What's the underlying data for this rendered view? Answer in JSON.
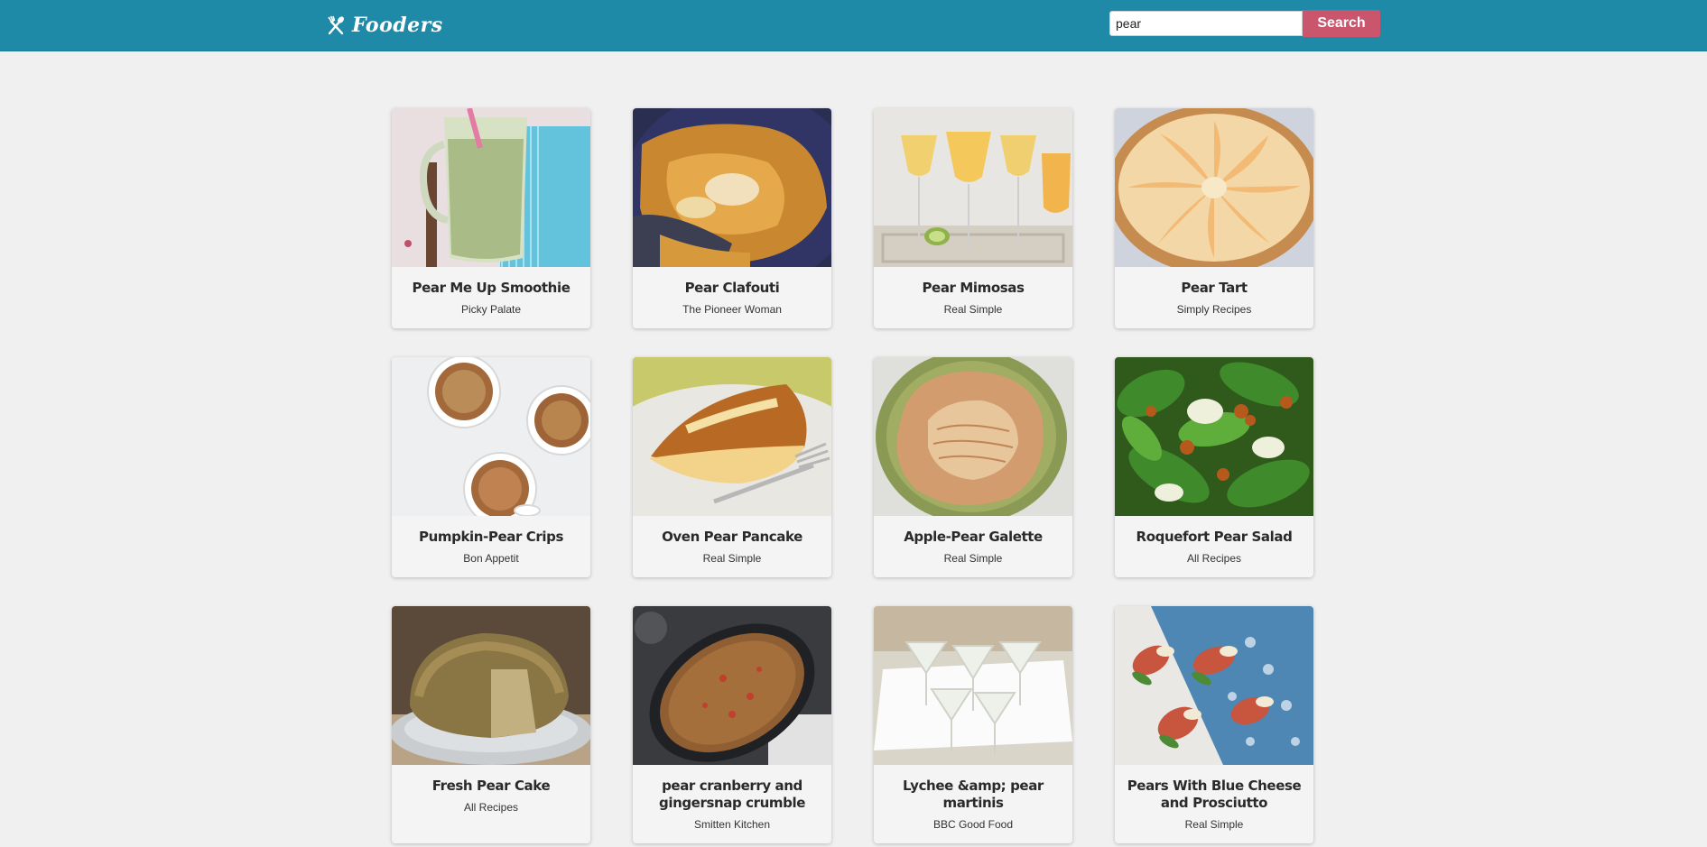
{
  "header": {
    "logo_text": "Fooders",
    "logo_icon": "fork-spoon-icon",
    "background_color": "#1f89a8"
  },
  "search": {
    "value": "pear",
    "button_label": "Search",
    "button_color": "#c9566c"
  },
  "recipes": [
    {
      "title": "Pear Me Up Smoothie",
      "source": "Picky Palate"
    },
    {
      "title": "Pear Clafouti",
      "source": "The Pioneer Woman"
    },
    {
      "title": "Pear Mimosas",
      "source": "Real Simple"
    },
    {
      "title": "Pear Tart",
      "source": "Simply Recipes"
    },
    {
      "title": "Pumpkin-Pear Crips",
      "source": "Bon Appetit"
    },
    {
      "title": "Oven Pear Pancake",
      "source": "Real Simple"
    },
    {
      "title": "Apple-Pear Galette",
      "source": "Real Simple"
    },
    {
      "title": "Roquefort Pear Salad",
      "source": "All Recipes"
    },
    {
      "title": "Fresh Pear Cake",
      "source": "All Recipes"
    },
    {
      "title": "pear cranberry and gingersnap crumble",
      "source": "Smitten Kitchen"
    },
    {
      "title": "Lychee &amp; pear martinis",
      "source": "BBC Good Food"
    },
    {
      "title": "Pears With Blue Cheese and Prosciutto",
      "source": "Real Simple"
    }
  ]
}
